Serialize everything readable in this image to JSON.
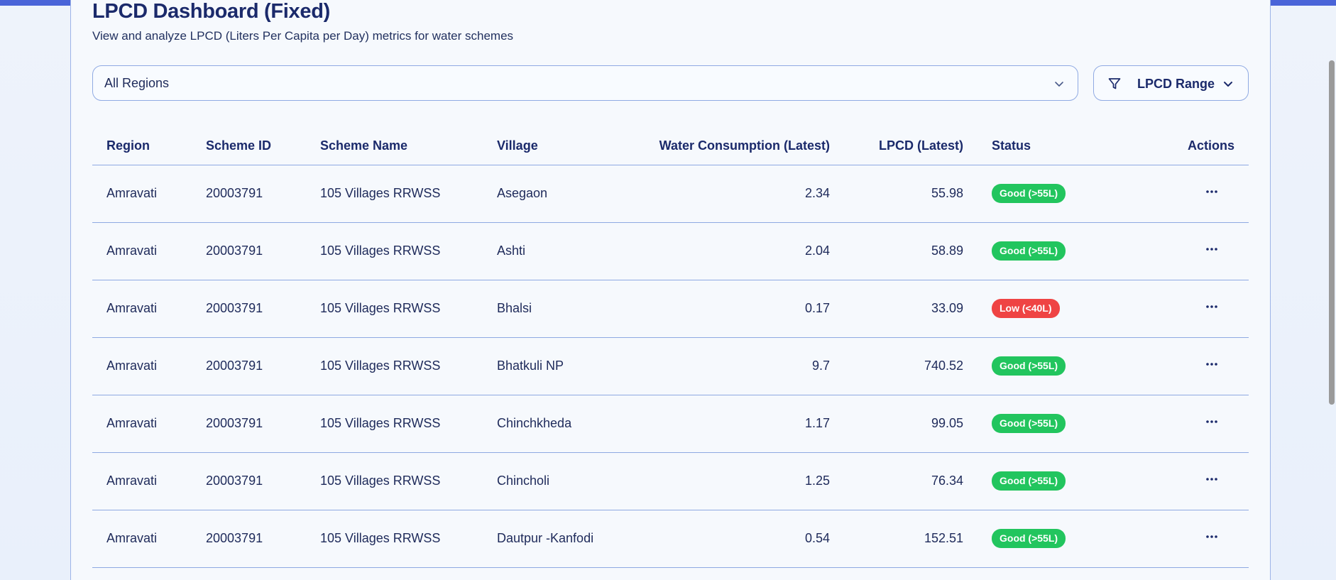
{
  "header": {
    "title": "LPCD Dashboard (Fixed)",
    "subtitle": "View and analyze LPCD (Liters Per Capita per Day) metrics for water schemes"
  },
  "filters": {
    "region_value": "All Regions",
    "range_label": "LPCD Range"
  },
  "table": {
    "columns": [
      "Region",
      "Scheme ID",
      "Scheme Name",
      "Village",
      "Water Consumption (Latest)",
      "LPCD (Latest)",
      "Status",
      "Actions"
    ],
    "rows": [
      {
        "region": "Amravati",
        "scheme_id": "20003791",
        "scheme_name": "105 Villages RRWSS",
        "village": "Asegaon",
        "consumption": "2.34",
        "lpcd": "55.98",
        "status": "Good (>55L)",
        "status_type": "good"
      },
      {
        "region": "Amravati",
        "scheme_id": "20003791",
        "scheme_name": "105 Villages RRWSS",
        "village": "Ashti",
        "consumption": "2.04",
        "lpcd": "58.89",
        "status": "Good (>55L)",
        "status_type": "good"
      },
      {
        "region": "Amravati",
        "scheme_id": "20003791",
        "scheme_name": "105 Villages RRWSS",
        "village": "Bhalsi",
        "consumption": "0.17",
        "lpcd": "33.09",
        "status": "Low (<40L)",
        "status_type": "low"
      },
      {
        "region": "Amravati",
        "scheme_id": "20003791",
        "scheme_name": "105 Villages RRWSS",
        "village": "Bhatkuli NP",
        "consumption": "9.7",
        "lpcd": "740.52",
        "status": "Good (>55L)",
        "status_type": "good"
      },
      {
        "region": "Amravati",
        "scheme_id": "20003791",
        "scheme_name": "105 Villages RRWSS",
        "village": "Chinchkheda",
        "consumption": "1.17",
        "lpcd": "99.05",
        "status": "Good (>55L)",
        "status_type": "good"
      },
      {
        "region": "Amravati",
        "scheme_id": "20003791",
        "scheme_name": "105 Villages RRWSS",
        "village": "Chincholi",
        "consumption": "1.25",
        "lpcd": "76.34",
        "status": "Good (>55L)",
        "status_type": "good"
      },
      {
        "region": "Amravati",
        "scheme_id": "20003791",
        "scheme_name": "105 Villages RRWSS",
        "village": "Dautpur -Kanfodi",
        "consumption": "0.54",
        "lpcd": "152.51",
        "status": "Good (>55L)",
        "status_type": "good"
      }
    ]
  },
  "colors": {
    "good": "#22c55e",
    "low": "#ef4444",
    "accent": "#4a64d8"
  },
  "icons": {
    "region_dropdown": "chevron-down-icon",
    "range_filter": "filter-icon",
    "row_actions": "more-horizontal-icon"
  }
}
